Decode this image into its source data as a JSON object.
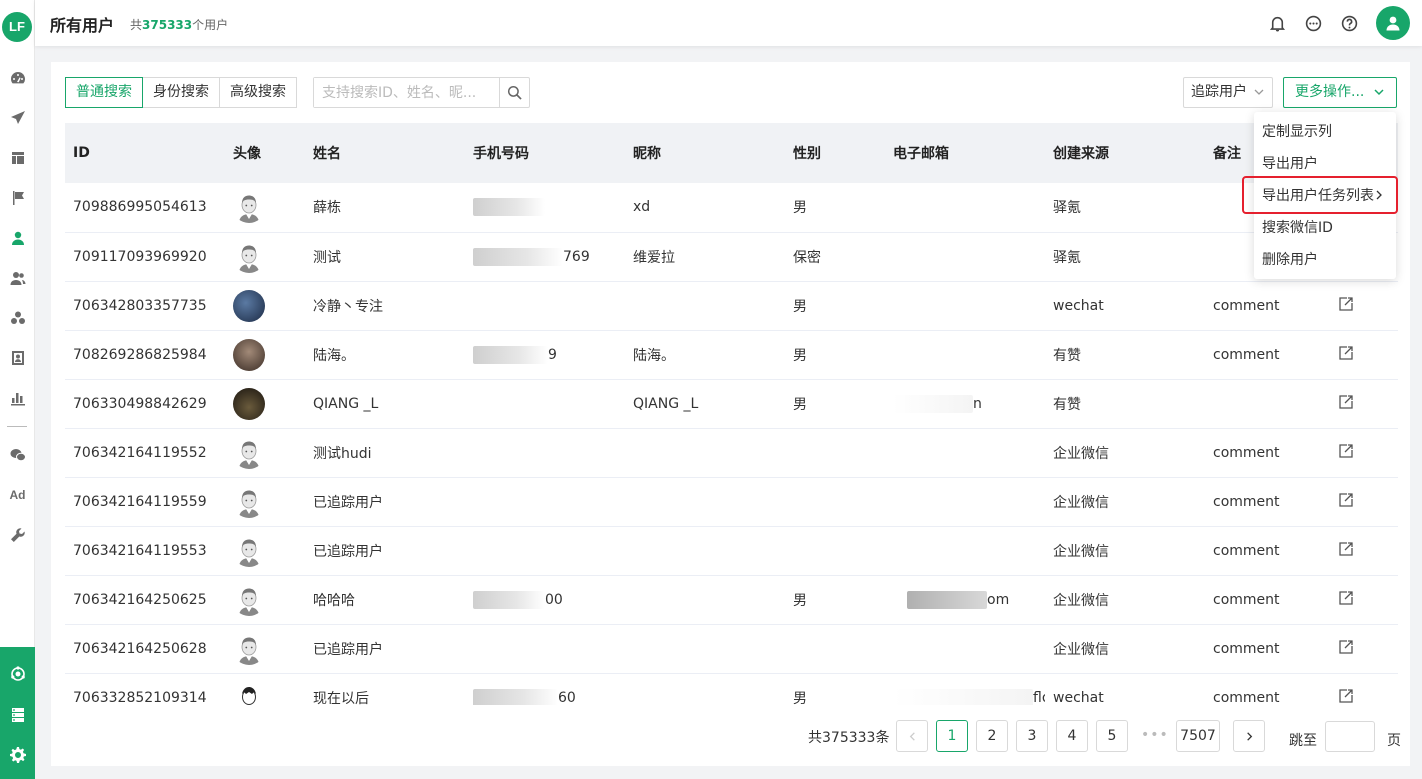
{
  "app": {
    "logo_text": "LF"
  },
  "header": {
    "title": "所有用户",
    "count_prefix": "共",
    "count_value": "375333",
    "count_suffix": "个用户",
    "icons": [
      "bell-icon",
      "chat-icon",
      "help-icon",
      "user-avatar-icon"
    ]
  },
  "sidenav": {
    "items": [
      "dashboard-icon",
      "send-icon",
      "layout-icon",
      "flag-icon",
      "user-icon",
      "users-icon",
      "segments-icon",
      "badge-icon",
      "chart-icon",
      "wechat-icon",
      "ad-icon",
      "wrench-icon"
    ],
    "ad_label": "Ad",
    "bottom_items": [
      "hub-icon",
      "server-icon",
      "settings-icon"
    ]
  },
  "search": {
    "tabs": [
      "普通搜索",
      "身份搜索",
      "高级搜索"
    ],
    "active_tab": 0,
    "placeholder": "支持搜索ID、姓名、昵..."
  },
  "toolbar": {
    "track_select": "追踪用户",
    "more_button": "更多操作..."
  },
  "dropdown": {
    "items": [
      "定制显示列",
      "导出用户",
      "导出用户任务列表",
      "搜索微信ID",
      "删除用户"
    ],
    "highlighted_index": 2
  },
  "table": {
    "columns": [
      "ID",
      "头像",
      "姓名",
      "手机号码",
      "昵称",
      "性别",
      "电子邮箱",
      "创建来源",
      "备注",
      ""
    ],
    "rows": [
      {
        "id": "709886995054613",
        "avatar": "default",
        "name": "薛栋",
        "phone": "",
        "nickname": "xd",
        "gender": "男",
        "email": "",
        "source": "驿氪",
        "note": ""
      },
      {
        "id": "709117093969920",
        "avatar": "default",
        "name": "测试",
        "phone": "769",
        "nickname": "维爱拉",
        "gender": "保密",
        "email": "",
        "source": "驿氪",
        "note": ""
      },
      {
        "id": "706342803357735",
        "avatar": "dark1",
        "name": "冷静丶专注",
        "phone": "",
        "nickname": "",
        "gender": "男",
        "email": "",
        "source": "wechat",
        "note": "comment"
      },
      {
        "id": "708269286825984",
        "avatar": "dark2",
        "name": "陆海。",
        "phone": "9",
        "nickname": "陆海。",
        "gender": "男",
        "email": "",
        "source": "有赞",
        "note": "comment"
      },
      {
        "id": "706330498842629",
        "avatar": "dark3",
        "name": "QIANG _L",
        "phone": "",
        "nickname": "QIANG _L",
        "gender": "男",
        "email": "n",
        "source": "有赞",
        "note": ""
      },
      {
        "id": "706342164119552",
        "avatar": "default",
        "name": "测试hudi",
        "phone": "",
        "nickname": "",
        "gender": "",
        "email": "",
        "source": "企业微信",
        "note": "comment"
      },
      {
        "id": "706342164119559",
        "avatar": "default",
        "name": "已追踪用户",
        "phone": "",
        "nickname": "",
        "gender": "",
        "email": "",
        "source": "企业微信",
        "note": "comment"
      },
      {
        "id": "706342164119553",
        "avatar": "default",
        "name": "已追踪用户",
        "phone": "",
        "nickname": "",
        "gender": "",
        "email": "",
        "source": "企业微信",
        "note": "comment"
      },
      {
        "id": "706342164250625",
        "avatar": "default",
        "name": "哈哈哈",
        "phone": "00",
        "nickname": "",
        "gender": "男",
        "email": "om",
        "source": "企业微信",
        "note": "comment"
      },
      {
        "id": "706342164250628",
        "avatar": "default",
        "name": "已追踪用户",
        "phone": "",
        "nickname": "",
        "gender": "",
        "email": "",
        "source": "企业微信",
        "note": "comment"
      },
      {
        "id": "706332852109314",
        "avatar": "sketch",
        "name": "现在以后",
        "phone": "60",
        "nickname": "",
        "gender": "男",
        "email": "flo",
        "source": "wechat",
        "note": "comment"
      }
    ]
  },
  "pagination": {
    "total_label": "共375333条",
    "pages": [
      "1",
      "2",
      "3",
      "4",
      "5"
    ],
    "ellipsis": "•••",
    "last_page": "7507",
    "active_page": "1",
    "jump_label": "跳至",
    "jump_unit": "页"
  },
  "colors": {
    "brand": "#18a66a",
    "highlight": "#e5202e"
  }
}
